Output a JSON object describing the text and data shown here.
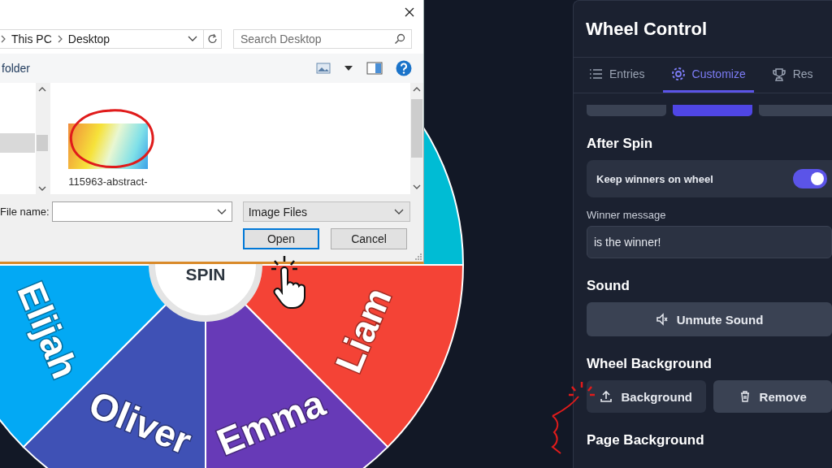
{
  "wheel": {
    "slices": [
      {
        "color": "#00bcd4"
      },
      {
        "name": "Liam",
        "color": "#f44336"
      },
      {
        "name": "Emma",
        "color": "#673ab7"
      },
      {
        "name": "Oliver",
        "color": "#3f51b5"
      },
      {
        "name": "Elijah",
        "color": "#03a9f4"
      }
    ],
    "spin_label": "SPIN"
  },
  "file_dialog": {
    "breadcrumb": [
      "This PC",
      "Desktop"
    ],
    "search": {
      "placeholder": "Search Desktop"
    },
    "toolbar_link": "folder",
    "files": [
      {
        "name": "115963-abstract-"
      }
    ],
    "file_name_label": "File name:",
    "file_type": "Image Files",
    "buttons": [
      {
        "label": "Open",
        "default": true
      },
      {
        "label": "Cancel",
        "default": false
      }
    ]
  },
  "panel": {
    "title": "Wheel Control",
    "tabs": [
      {
        "label": "Entries",
        "kind": "list",
        "selected": false
      },
      {
        "label": "Customize",
        "kind": "gear",
        "selected": true
      },
      {
        "label": "Res",
        "kind": "trophy",
        "selected": false
      }
    ],
    "speed_options": [
      {
        "selected": false
      },
      {
        "selected": true
      },
      {
        "selected": false
      }
    ],
    "after_spin": {
      "heading": "After Spin",
      "toggle": {
        "label": "Keep winners on wheel",
        "on": true
      },
      "message": {
        "label": "Winner message",
        "value": "is the winner!"
      }
    },
    "sound": {
      "heading": "Sound",
      "button": "Unmute Sound"
    },
    "wheel_background": {
      "heading": "Wheel Background",
      "buttons": [
        {
          "label": "Background",
          "kind": "upload"
        },
        {
          "label": "Remove",
          "kind": "delete"
        }
      ]
    },
    "page_background": {
      "heading": "Page Background"
    }
  }
}
